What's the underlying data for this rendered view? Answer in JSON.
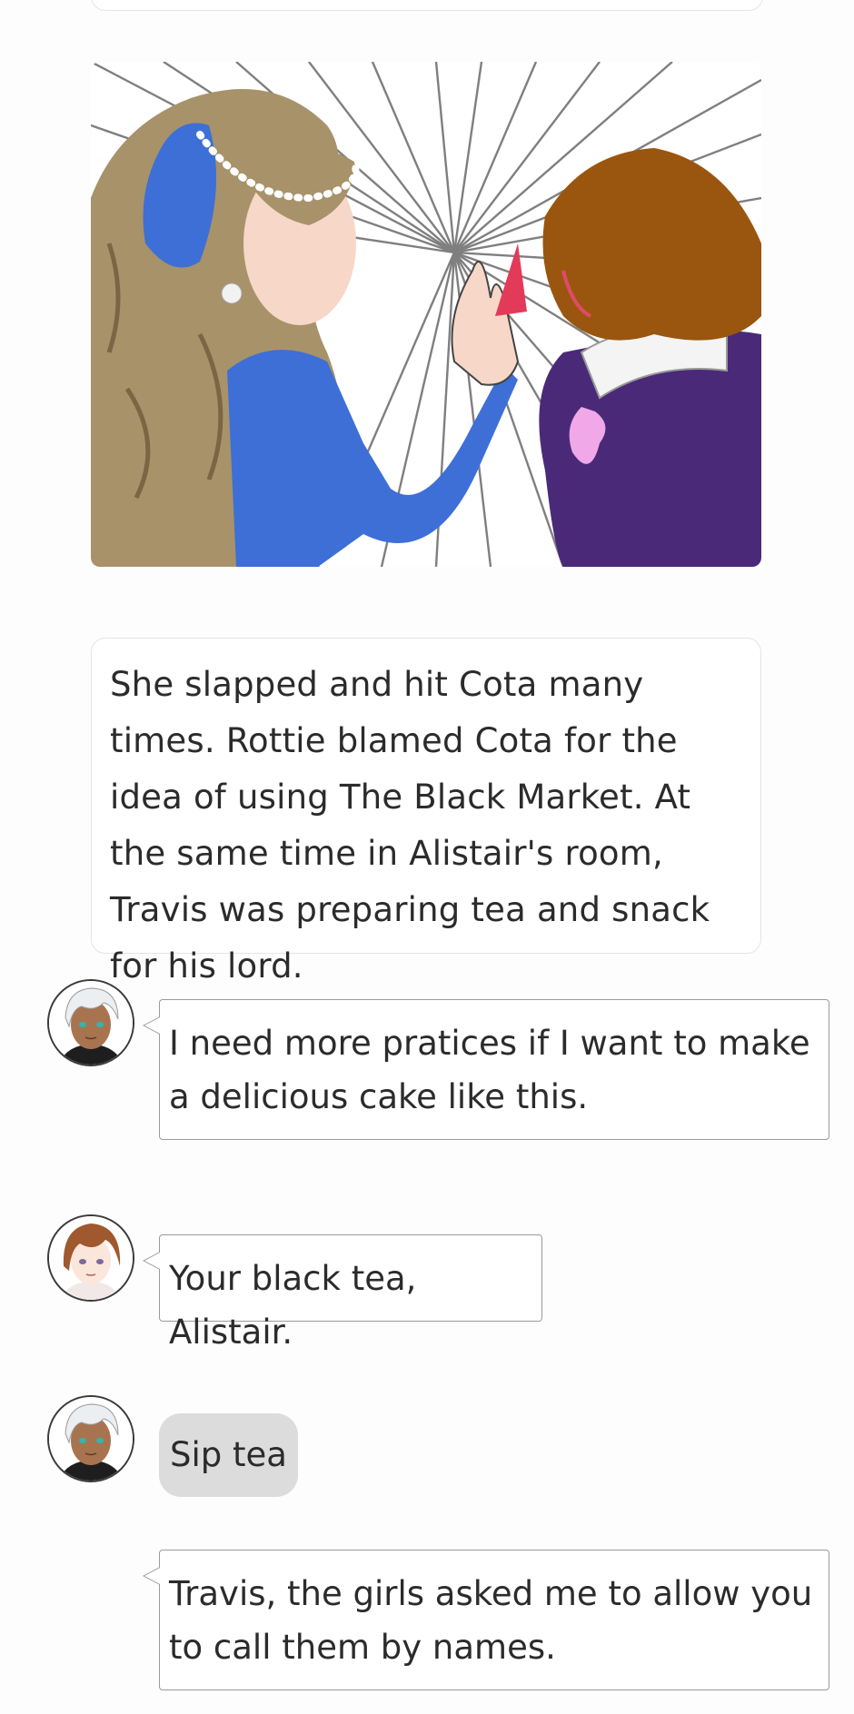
{
  "story": {
    "narration": "She slapped and hit Cota many times. Rottie blamed Cota for the idea of using The Black Market. At the same time in Alistair's room, Travis was preparing tea and snack for his lord.",
    "messages": [
      {
        "speaker_icon": "alistair-avatar",
        "text": "I need more pratices if I want to make a delicious cake like this."
      },
      {
        "speaker_icon": "travis-avatar",
        "text": "Your black tea, Alistair."
      },
      {
        "speaker_icon": "alistair-avatar",
        "action": "Sip tea"
      },
      {
        "text": "Travis, the girls asked me to allow you to call them by names."
      }
    ]
  },
  "colors": {
    "rottie_dress": "#3d6fd6",
    "rottie_hair": "#a8926a",
    "cota_hair": "#9a560f",
    "cota_dress": "#4a2a78",
    "bow_pink": "#f0a8e8",
    "action_bg": "#dcdcdc"
  }
}
